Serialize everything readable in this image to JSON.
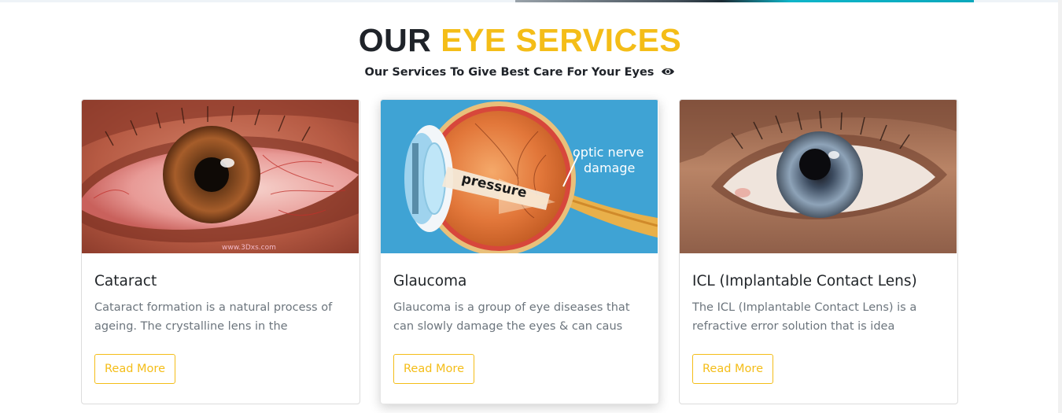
{
  "section": {
    "title_dark": "OUR",
    "title_accent": "EYE SERVICES",
    "subtitle": "Our Services To Give Best Care For Your Eyes",
    "subtitle_icon": "eye-icon",
    "accent_color": "#f4bd18"
  },
  "cards": [
    {
      "image": "red-eye-photo",
      "image_watermark": "www.3Dxs.com",
      "title": "Cataract",
      "text": "Cataract formation is a natural process of ageing. The crystalline lens in the",
      "button": "Read More"
    },
    {
      "image": "glaucoma-eye-diagram",
      "image_labels": {
        "pressure": "pressure",
        "optic_line1": "optic nerve",
        "optic_line2": "damage"
      },
      "title": "Glaucoma",
      "text": "Glaucoma is a group of eye diseases that can slowly damage the eyes & can caus",
      "button": "Read More"
    },
    {
      "image": "blue-eye-photo",
      "title": "ICL (Implantable Contact Lens)",
      "text": "The ICL (Implantable Contact Lens) is a refractive error solution that is idea",
      "button": "Read More"
    }
  ]
}
